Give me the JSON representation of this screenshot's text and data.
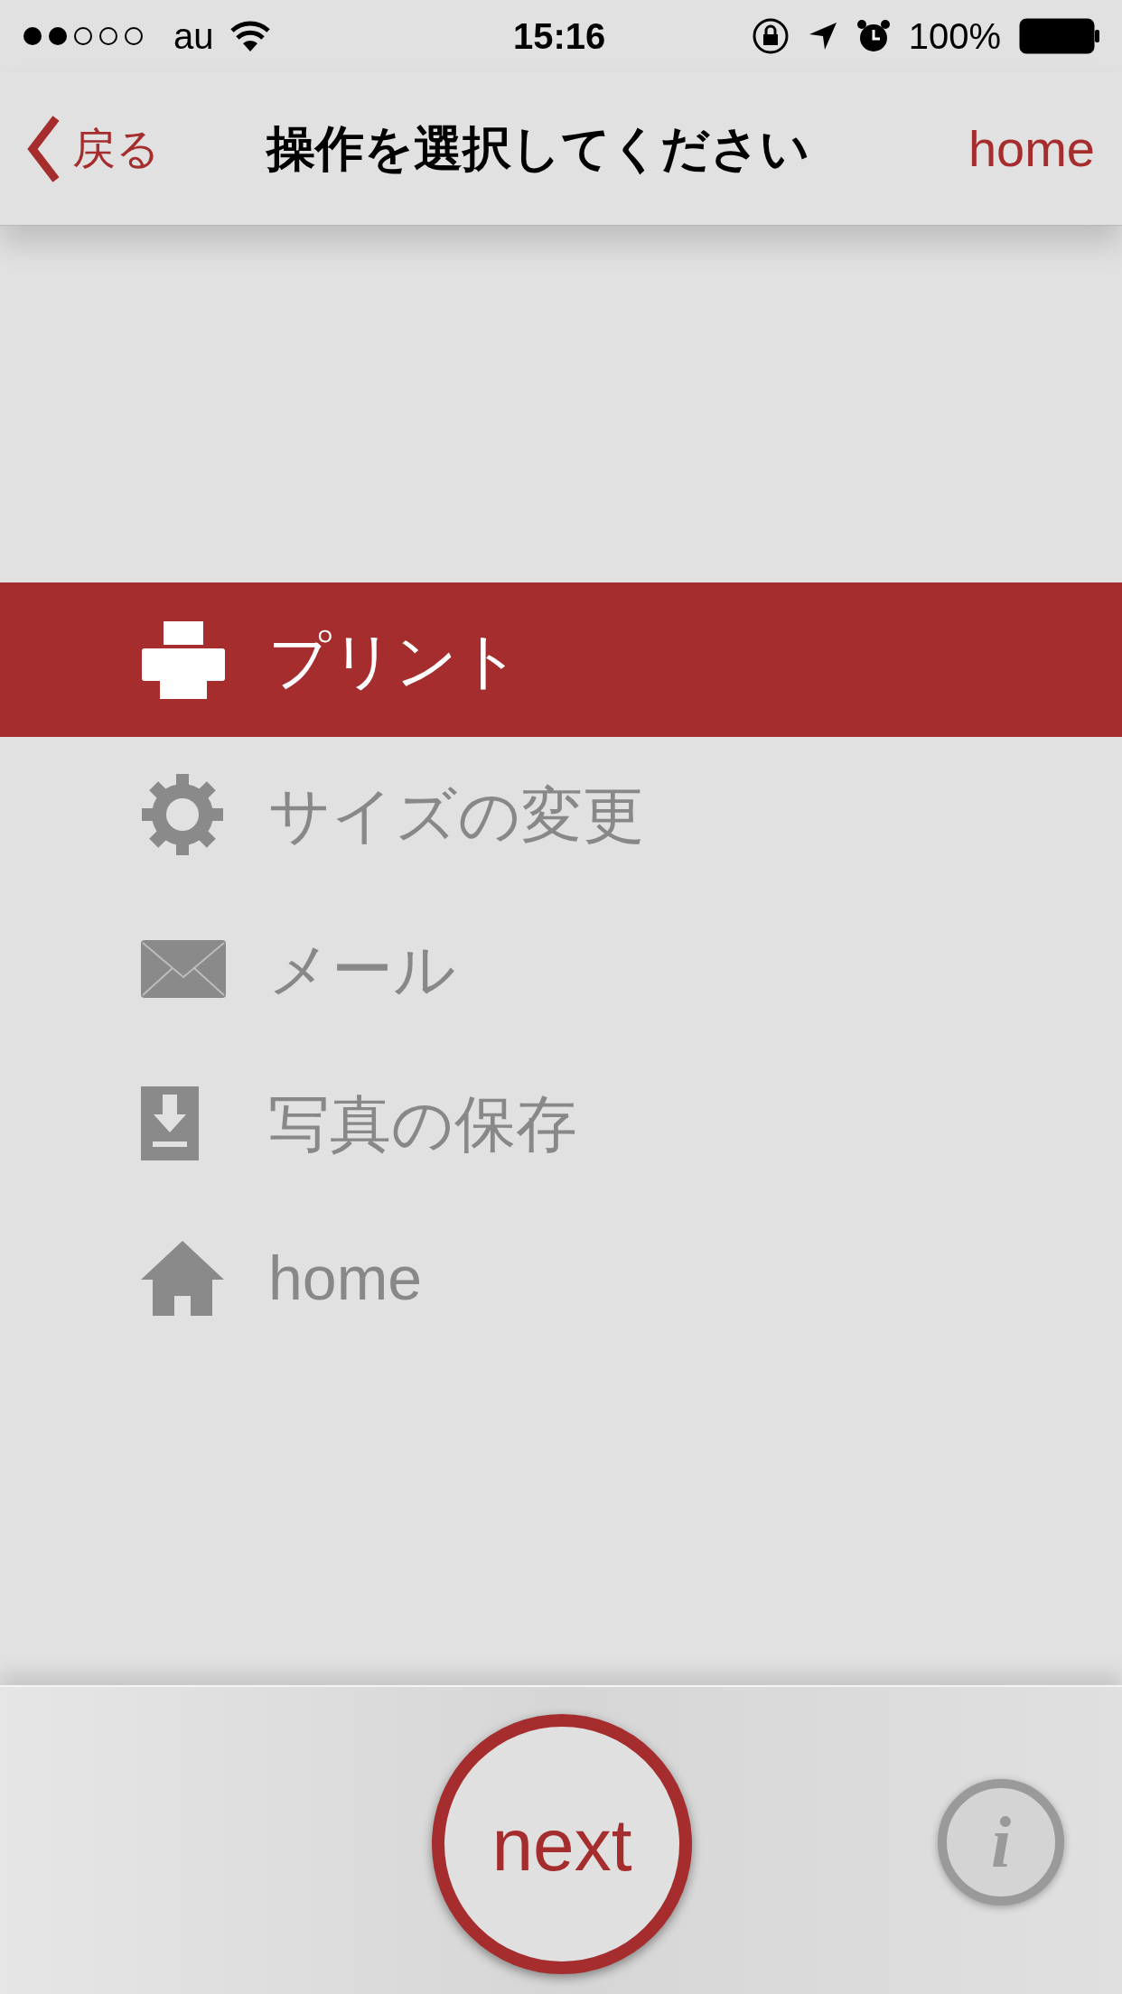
{
  "status_bar": {
    "carrier": "au",
    "time": "15:16",
    "battery": "100%"
  },
  "nav_bar": {
    "back": "戻る",
    "title": "操作を選択してください",
    "right": "home"
  },
  "menu": [
    {
      "label": "プリント",
      "selected": true
    },
    {
      "label": "サイズの変更",
      "selected": false
    },
    {
      "label": "メール",
      "selected": false
    },
    {
      "label": "写真の保存",
      "selected": false
    },
    {
      "label": "home",
      "selected": false
    }
  ],
  "bottom_bar": {
    "next": "next",
    "info": "i"
  }
}
